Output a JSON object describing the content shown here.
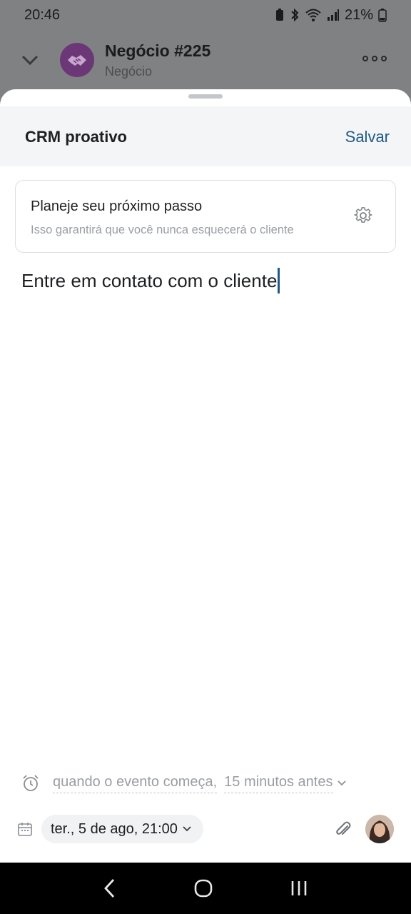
{
  "status": {
    "time": "20:46",
    "battery": "21%"
  },
  "deal": {
    "title": "Negócio #225",
    "subtitle": "Negócio"
  },
  "sheet": {
    "title": "CRM proativo",
    "save_label": "Salvar"
  },
  "plan": {
    "title": "Planeje seu próximo passo",
    "subtitle": "Isso garantirá que você nunca esquecerá o cliente"
  },
  "note": {
    "text": "Entre em contato com o cliente"
  },
  "reminder": {
    "when": "quando o evento começa,",
    "offset": "15 minutos antes"
  },
  "footer": {
    "date": "ter., 5 de ago, 21:00"
  },
  "colors": {
    "accent": "#1f5a86",
    "deal_avatar": "#6b3777"
  },
  "icons": [
    "chevron-down-icon",
    "handshake-icon",
    "more-icon",
    "gear-icon",
    "alarm-icon",
    "calendar-icon",
    "paperclip-icon",
    "back-icon",
    "home-icon",
    "recents-icon"
  ]
}
